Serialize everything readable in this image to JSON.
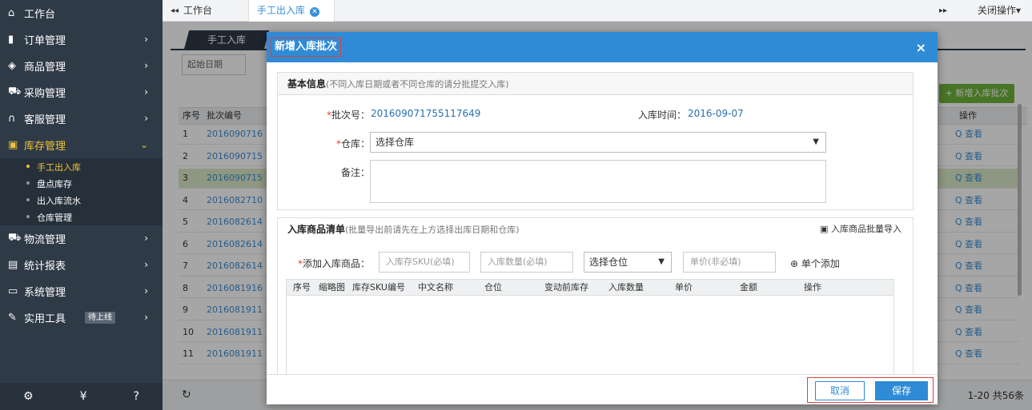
{
  "sidebar": {
    "items": [
      {
        "label": "工作台",
        "icon": "home-icon",
        "glyph": "⌂"
      },
      {
        "label": "订单管理",
        "icon": "clipboard-icon",
        "glyph": "▮",
        "arrow": "›"
      },
      {
        "label": "商品管理",
        "icon": "goods-icon",
        "glyph": "◈",
        "arrow": "›"
      },
      {
        "label": "采购管理",
        "icon": "cart-icon",
        "glyph": "⛟",
        "arrow": "›"
      },
      {
        "label": "客服管理",
        "icon": "headset-icon",
        "glyph": "∩",
        "arrow": "›"
      },
      {
        "label": "库存管理",
        "icon": "box-icon",
        "glyph": "▣",
        "arrow": "⌄"
      }
    ],
    "subitems": [
      "手工出入库",
      "盘点库存",
      "出入库流水",
      "仓库管理"
    ],
    "items2": [
      {
        "label": "物流管理",
        "icon": "truck-icon",
        "glyph": "⛟",
        "arrow": "›"
      },
      {
        "label": "统计报表",
        "icon": "report-icon",
        "glyph": "▤",
        "arrow": "›"
      },
      {
        "label": "系统管理",
        "icon": "monitor-icon",
        "glyph": "▭",
        "arrow": "›"
      },
      {
        "label": "实用工具",
        "icon": "wrench-icon",
        "glyph": "✎",
        "arrow": "›",
        "badge": "待上线"
      }
    ],
    "footer_icons": [
      "gear-icon",
      "yen-icon",
      "help-icon"
    ],
    "footer_glyphs": [
      "⚙",
      "¥",
      "?"
    ]
  },
  "topbar": {
    "back": "◂◂",
    "home_tab": "工作台",
    "active_tab": "手工出入库",
    "forward": "▸▸",
    "close_ops": "关闭操作▾"
  },
  "content": {
    "subtab": "手工入库",
    "start_date": "起始日期",
    "add_batch": "+ 新增入库批次",
    "columns": [
      "序号",
      "批次编号",
      "操作"
    ],
    "rows": [
      {
        "n": "1",
        "batch": "2016090716",
        "action": "Q 查看"
      },
      {
        "n": "2",
        "batch": "2016090715",
        "action": "Q 查看"
      },
      {
        "n": "3",
        "batch": "2016090715",
        "action": "Q 查看"
      },
      {
        "n": "4",
        "batch": "2016082710",
        "action": "Q 查看"
      },
      {
        "n": "5",
        "batch": "2016082614",
        "action": "Q 查看"
      },
      {
        "n": "6",
        "batch": "2016082614",
        "action": "Q 查看"
      },
      {
        "n": "7",
        "batch": "2016082614",
        "action": "Q 查看"
      },
      {
        "n": "8",
        "batch": "2016081916",
        "action": "Q 查看"
      },
      {
        "n": "9",
        "batch": "2016081911",
        "action": "Q 查看"
      },
      {
        "n": "10",
        "batch": "2016081911",
        "action": "Q 查看"
      },
      {
        "n": "11",
        "batch": "2016081911",
        "action": "Q 查看"
      }
    ],
    "refresh": "↻",
    "pager": "1-20  共56条"
  },
  "modal": {
    "title": "新增入库批次",
    "close": "×",
    "basic_title": "基本信息",
    "basic_note": "(不同入库日期或者不同仓库的请分批提交入库)",
    "batch_label": "*批次号：",
    "batch_value": "201609071755117649",
    "time_label": "入库时间：",
    "time_value": "2016-09-07",
    "warehouse_label": "*仓库：",
    "warehouse_value": "选择仓库",
    "remark_label": "备注：",
    "list_title": "入库商品清单",
    "list_note": "(批量导出前请先在上方选择出库日期和仓库)",
    "import_label": "入库商品批量导入",
    "add_label": "*添加入库商品：",
    "sku_placeholder": "入库存SKU(必填)",
    "qty_placeholder": "入库数量(必填)",
    "location_value": "选择仓位",
    "price_placeholder": "单价(非必填)",
    "single_add": "单个添加",
    "grid_columns": [
      "序号",
      "缩略图",
      "库存SKU编号",
      "中文名称",
      "仓位",
      "变动前库存",
      "入库数量",
      "单价",
      "金额",
      "操作"
    ],
    "cancel": "取消",
    "save": "保存"
  }
}
